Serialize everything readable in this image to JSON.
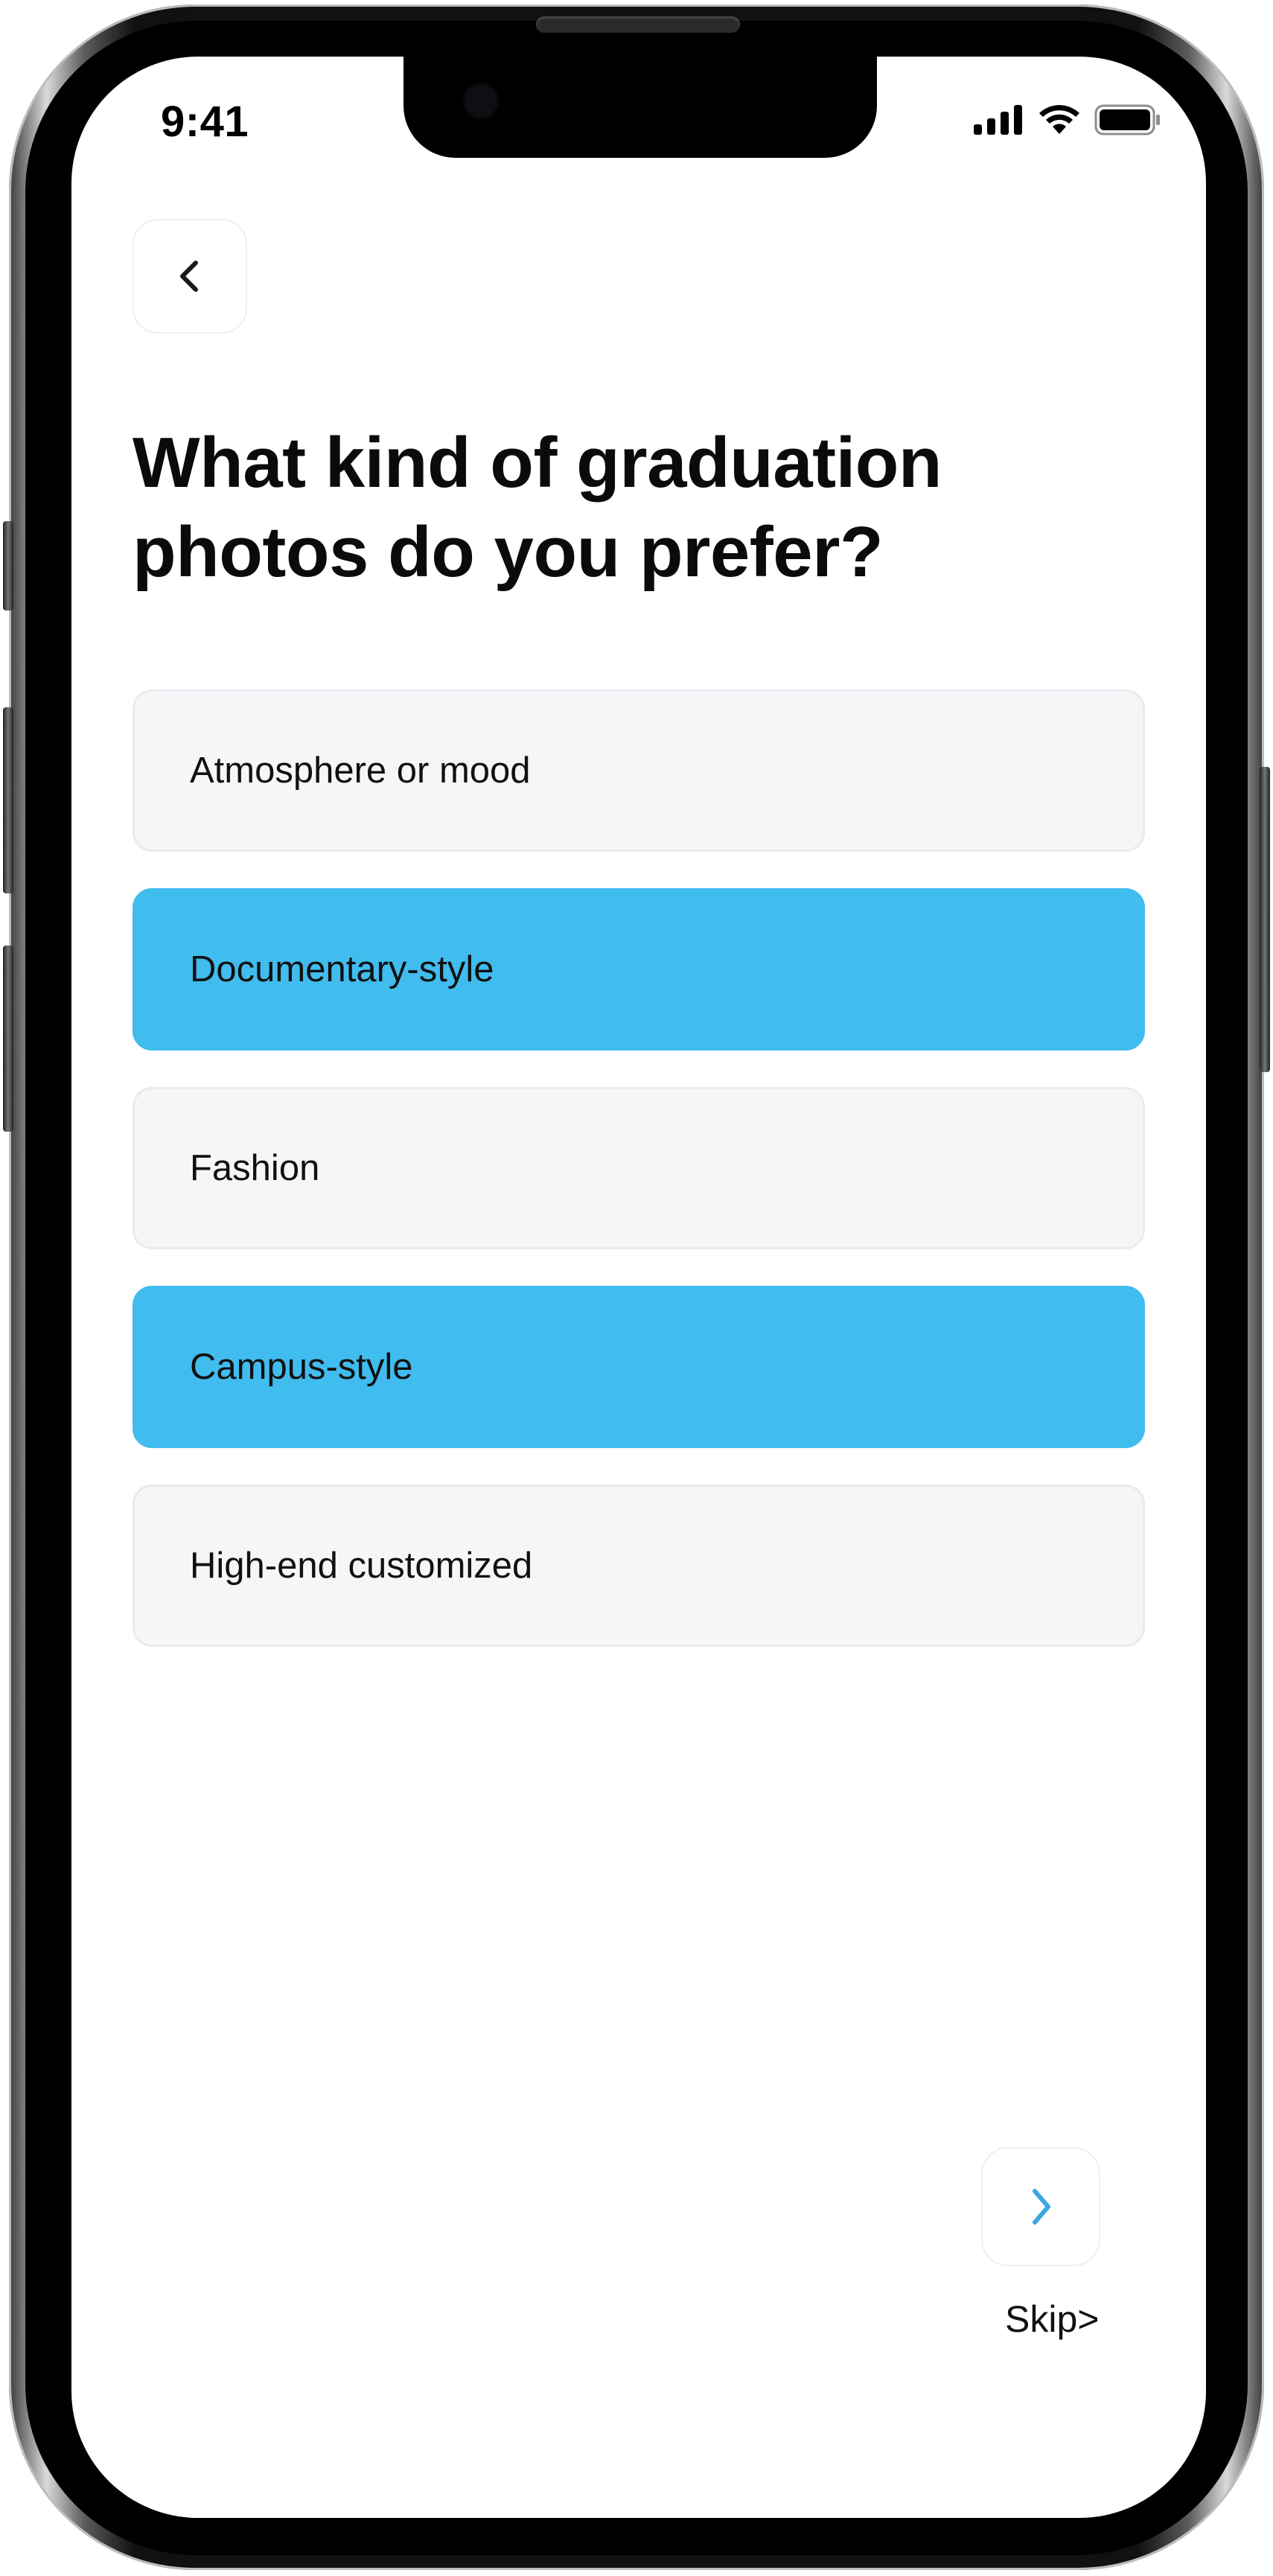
{
  "status_bar": {
    "time": "9:41"
  },
  "header": {
    "back_icon": "chevron-left-icon"
  },
  "question": {
    "title": "What kind of graduation photos do you prefer?"
  },
  "options": [
    {
      "label": "Atmosphere or mood",
      "selected": false
    },
    {
      "label": "Documentary-style",
      "selected": true
    },
    {
      "label": "Fashion",
      "selected": false
    },
    {
      "label": "Campus-style",
      "selected": true
    },
    {
      "label": "High-end customized",
      "selected": false
    }
  ],
  "footer": {
    "next_icon": "chevron-right-icon",
    "skip_label": "Skip>"
  },
  "colors": {
    "selected_option": "#41bcee",
    "unselected_option": "#f5f6f8",
    "accent": "#3aa7e0"
  }
}
